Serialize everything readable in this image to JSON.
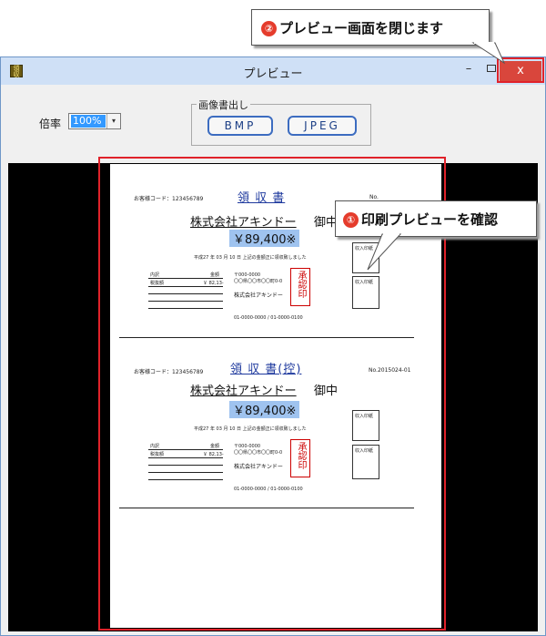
{
  "window": {
    "title": "プレビュー",
    "app_icon_text": "領収",
    "min_glyph": "–",
    "close_glyph": "x",
    "active_close_color": "#d9463c"
  },
  "toolbar": {
    "zoom_label": "倍率",
    "zoom_value": "100%",
    "zoom_arrow": "▾",
    "image_group_label": "画像書出し",
    "bmp_label": "BMP",
    "jpeg_label": "JPEG"
  },
  "receipts": [
    {
      "title": "領 収 書",
      "customer_code": "お客様コード：123456789",
      "number": "No.",
      "addressee": "株式会社アキンドー",
      "honorific": "御中",
      "amount": "￥89,400※",
      "note": "平成27 年 03 月 10 日 上記の金額正に領収致しました",
      "breakdown_labels": [
        "内訳",
        "金額"
      ],
      "breakdown_row": [
        "税抜額",
        "￥  82,13-"
      ],
      "issuer": "株式会社アキンドー",
      "phones": "01-0000-0000 / 01-0000-0100",
      "stamp_text": "承認印",
      "seal_label": "収入印紙"
    },
    {
      "title": "領 収 書(控)",
      "customer_code": "お客様コード：123456789",
      "number": "No.2015024-01",
      "addressee": "株式会社アキンドー",
      "honorific": "御中",
      "amount": "￥89,400※",
      "note": "平成27 年 03 月 10 日 上記の金額正に領収致しました",
      "breakdown_labels": [
        "内訳",
        "金額"
      ],
      "breakdown_row": [
        "税抜額",
        "￥  82,13-"
      ],
      "issuer": "株式会社アキンドー",
      "phones": "01-0000-0000 / 01-0000-0100",
      "stamp_text": "承認印",
      "seal_label": "収入印紙"
    }
  ],
  "annotations": {
    "close_hint_num": "②",
    "close_hint": "プレビュー画面を閉じます",
    "preview_hint_num": "①",
    "preview_hint": "印刷プレビューを確認",
    "highlight_color": "#e0222a"
  }
}
